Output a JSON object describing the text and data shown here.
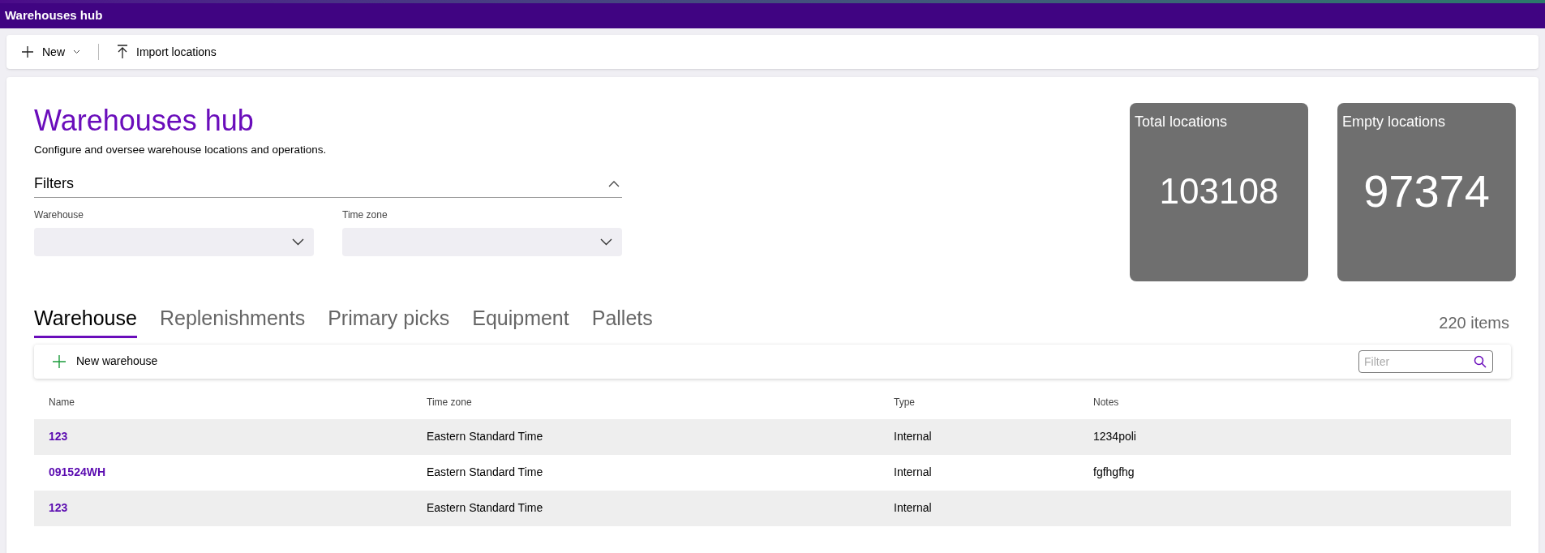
{
  "window": {
    "title": "Warehouses hub"
  },
  "toolbar": [
    {
      "kind": "new",
      "label": "New"
    },
    {
      "kind": "import",
      "label": "Import locations"
    }
  ],
  "header": {
    "title": "Warehouses hub",
    "subtitle": "Configure and oversee warehouse locations and operations."
  },
  "filters": {
    "title": "Filters",
    "expanded": true,
    "fields": [
      {
        "label": "Warehouse"
      },
      {
        "label": "Time zone"
      }
    ]
  },
  "stats": [
    {
      "label": "Total locations",
      "value": "103108"
    },
    {
      "label": "Empty locations",
      "value": "97374"
    }
  ],
  "tabs": [
    {
      "label": "Warehouse",
      "selected": true
    },
    {
      "label": "Replenishments",
      "selected": false
    },
    {
      "label": "Primary picks",
      "selected": false
    },
    {
      "label": "Equipment",
      "selected": false
    },
    {
      "label": "Pallets",
      "selected": false
    }
  ],
  "item_count": "220 items",
  "grid_toolbar": {
    "new_button": "New warehouse",
    "filter": {
      "placeholder": "Filter"
    }
  },
  "table": {
    "columns": [
      "Name",
      "Time zone",
      "Type",
      "Notes"
    ],
    "rows": [
      {
        "name": "123",
        "time_zone": "Eastern Standard Time",
        "type": "Internal",
        "notes": "1234poli"
      },
      {
        "name": "091524WH",
        "time_zone": "Eastern Standard Time",
        "type": "Internal",
        "notes": "fgfhgfhg"
      },
      {
        "name": "123",
        "time_zone": "Eastern Standard Time",
        "type": "Internal"
      }
    ]
  }
}
